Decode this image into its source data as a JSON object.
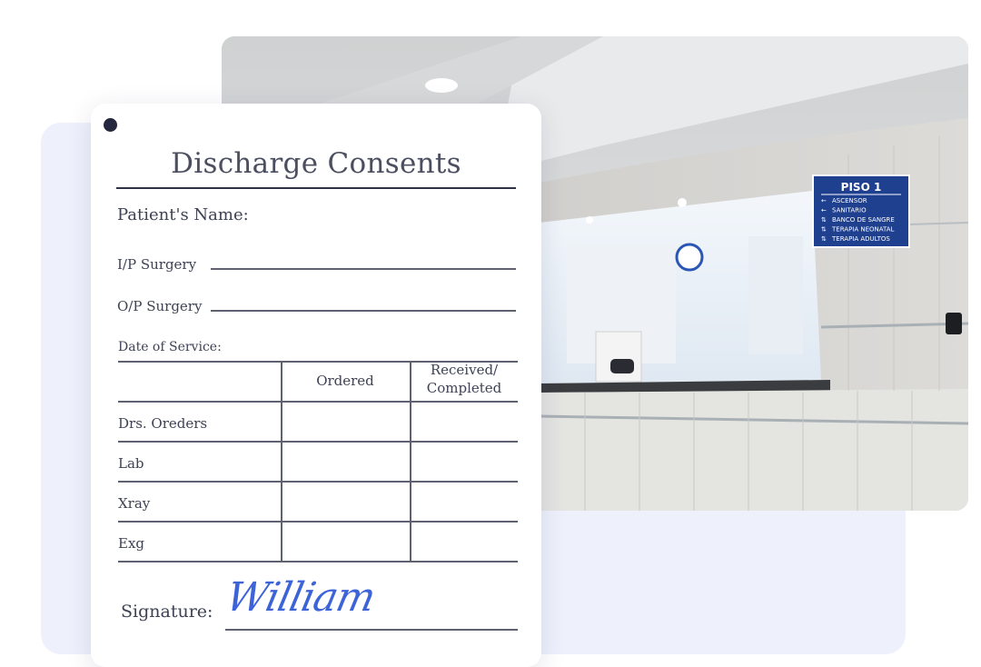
{
  "form": {
    "title": "Discharge Consents",
    "patient_label": "Patient's Name:",
    "ip_surgery_label": "I/P Surgery",
    "op_surgery_label": "O/P Surgery",
    "date_of_service_label": "Date of Service:",
    "table": {
      "headers": [
        "",
        "Ordered",
        "Received/",
        "Completed"
      ],
      "rows": [
        "Drs. Oreders",
        "Lab",
        "Xray",
        "Exg"
      ]
    },
    "signature_label": "Signature:",
    "signature_value": "William"
  },
  "photo": {
    "sign": {
      "title": "PISO 1",
      "items": [
        "ASCENSOR",
        "SANITARIO",
        "BANCO DE SANGRE",
        "TERAPIA NEONATAL",
        "TERAPIA ADULTOS"
      ]
    }
  },
  "colors": {
    "background_card": "#eef1fc",
    "signature_ink": "#3d63d8",
    "sign_blue": "#1f3f8f",
    "text": "#3e4254"
  }
}
